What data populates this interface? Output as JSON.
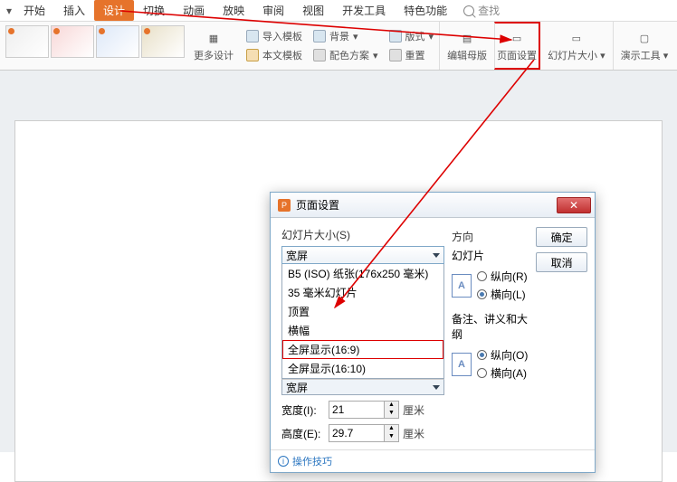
{
  "tabs": {
    "items": [
      "开始",
      "插入",
      "设计",
      "切换",
      "动画",
      "放映",
      "审阅",
      "视图",
      "开发工具",
      "特色功能"
    ],
    "active_index": 2,
    "search_placeholder": "查找"
  },
  "toolbar": {
    "more_designs": "更多设计",
    "import_template": "导入模板",
    "this_template": "本文模板",
    "background": "背景",
    "color_scheme": "配色方案",
    "layout": "版式",
    "reset": "重置",
    "edit_master": "编辑母版",
    "page_setup": "页面设置",
    "slide_size": "幻灯片大小",
    "presentation_tools": "演示工具"
  },
  "dialog": {
    "title": "页面设置",
    "size_group": "幻灯片大小(S)",
    "combo_value": "宽屏",
    "options": [
      "B5 (ISO) 纸张(176x250 毫米)",
      "35 毫米幻灯片",
      "顶置",
      "横幅",
      "全屏显示(16:9)",
      "全屏显示(16:10)"
    ],
    "footer_value": "宽屏",
    "width_label": "宽度(I):",
    "width_value": "21",
    "height_label": "高度(E):",
    "height_value": "29.7",
    "unit": "厘米",
    "orientation_group": "方向",
    "slide_sub": "幻灯片",
    "portrait": "纵向(R)",
    "landscape": "横向(L)",
    "notes_sub": "备注、讲义和大纲",
    "portrait2": "纵向(O)",
    "landscape2": "横向(A)",
    "ok": "确定",
    "cancel": "取消",
    "tip": "操作技巧"
  }
}
